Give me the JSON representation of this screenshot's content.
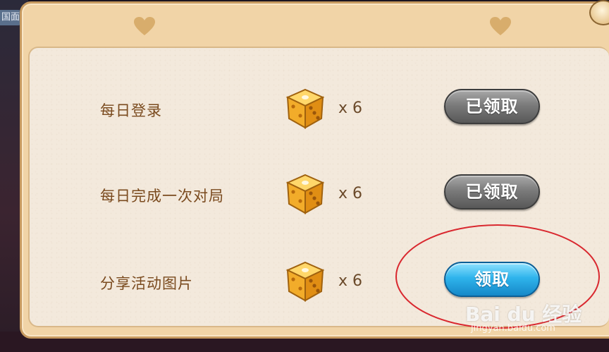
{
  "background": {
    "side_tab": "国面"
  },
  "tasks": [
    {
      "label": "每日登录",
      "count": "x 6",
      "button": "已领取",
      "state": "claimed"
    },
    {
      "label": "每日完成一次对局",
      "count": "x 6",
      "button": "已领取",
      "state": "claimed"
    },
    {
      "label": "分享活动图片",
      "count": "x 6",
      "button": "领取",
      "state": "available"
    }
  ],
  "icons": {
    "heart": "heart-icon",
    "dice": "dice-icon",
    "close": "close-icon"
  },
  "colors": {
    "claimed_button": "#6f6f6f",
    "claim_button": "#2fb4ec",
    "highlight": "#d9282f",
    "label_text": "#7a4a1e"
  },
  "watermark": {
    "main": "Bai du 经验",
    "sub": "jingyan.baidu.com"
  }
}
